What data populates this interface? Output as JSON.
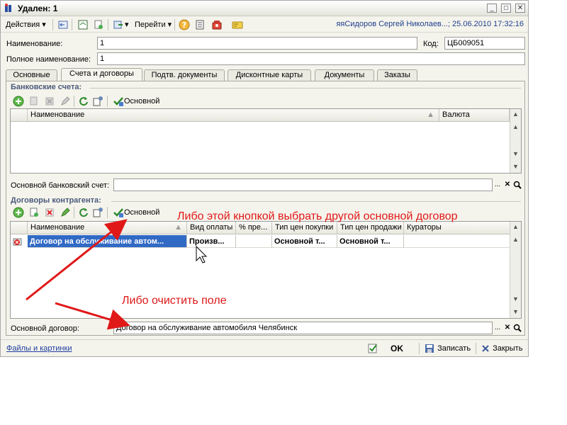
{
  "window": {
    "title": "Удален: 1"
  },
  "toolbar": {
    "actions_label": "Действия",
    "goto_label": "Перейти",
    "user_info": "яяСидоров Сергей Николаев...; 25.06.2010 17:32:16"
  },
  "header": {
    "name_label": "Наименование:",
    "name_value": "1",
    "code_label": "Код:",
    "code_value": "ЦБ009051",
    "fullname_label": "Полное наименование:",
    "fullname_value": "1"
  },
  "tabs": [
    {
      "label": "Основные"
    },
    {
      "label": "Счета и договоры"
    },
    {
      "label": "Подтв. документы"
    },
    {
      "label": "Дисконтные карты"
    },
    {
      "label": "Документы"
    },
    {
      "label": "Заказы"
    }
  ],
  "bank": {
    "title": "Банковские счета:",
    "main_button": "Основной",
    "columns": [
      "Наименование",
      "Валюта"
    ],
    "main_account_label": "Основной банковский счет:",
    "main_account_value": ""
  },
  "contracts": {
    "title": "Договоры контрагента:",
    "main_button": "Основной",
    "columns": [
      "Наименование",
      "Вид оплаты",
      "% пре...",
      "Тип цен покупки",
      "Тип цен продажи",
      "Кураторы"
    ],
    "rows": [
      {
        "name": "Договор на обслуживание автом...",
        "payment": "Произв...",
        "pct": "",
        "buy_price": "Основной т...",
        "sell_price": "Основной т...",
        "curators": ""
      }
    ],
    "main_contract_label": "Основной договор:",
    "main_contract_value": "Договор на обслуживание автомобиля Челябинск"
  },
  "statusbar": {
    "files_link": "Файлы и картинки",
    "ok_label": "OK",
    "save_label": "Записать",
    "close_label": "Закрыть"
  },
  "annotations": {
    "text1": "Либо этой кнопкой выбрать другой основной договор",
    "text2": "Либо очистить поле",
    "color": "#e01818"
  }
}
